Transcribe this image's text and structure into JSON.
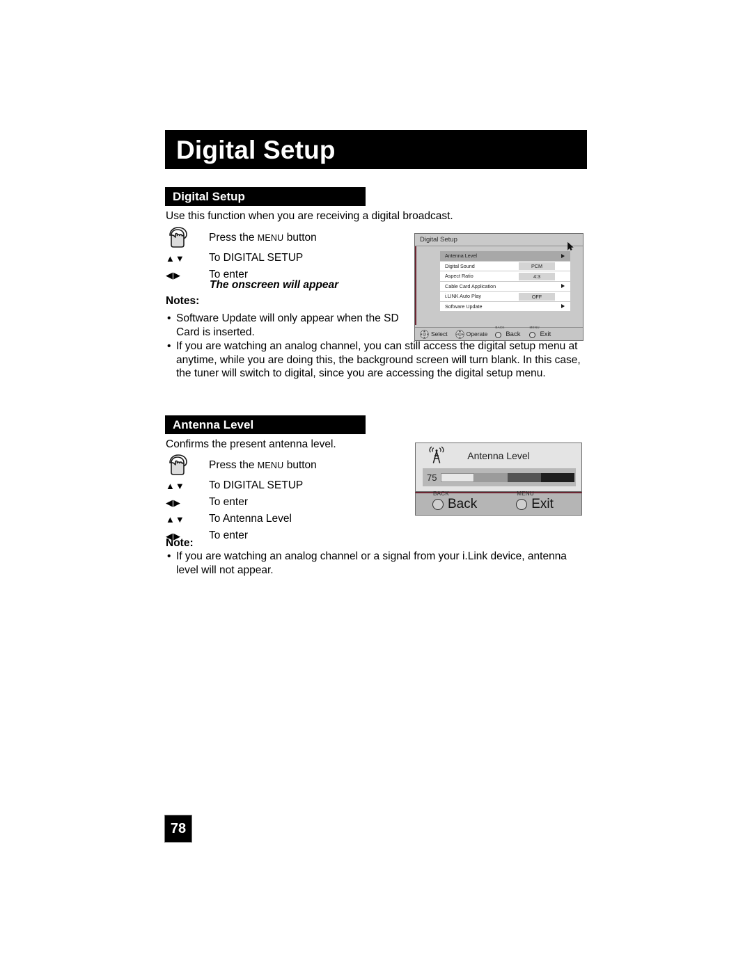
{
  "page": {
    "banner_title": "Digital Setup",
    "page_number": "78"
  },
  "sections": [
    {
      "heading": "Digital Setup",
      "intro": "Use this function when you are receiving a digital broadcast.",
      "steps": [
        {
          "icon": "hand-press-icon",
          "label_prefix": "Press the ",
          "label_smallcaps": "MENU",
          "label_suffix": " button"
        },
        {
          "icon": "up-down-arrows-icon",
          "arrows": "▲▼",
          "label": "To DIGITAL SETUP"
        },
        {
          "icon": "left-right-arrows-icon",
          "arrows": "◀▶",
          "label": "To enter"
        }
      ],
      "onscreen_note": "The onscreen will appear",
      "notes_heading": "Notes:",
      "notes": [
        "Software Update will only appear when the SD Card is inserted.",
        "If you are watching an analog channel, you can still access the digital setup menu at anytime, while you are doing this, the background screen will turn blank.  In this case, the tuner will switch to digital, since you are accessing the digital setup menu."
      ]
    },
    {
      "heading": "Antenna Level",
      "intro": "Confirms the present antenna level.",
      "steps": [
        {
          "icon": "hand-press-icon",
          "label_prefix": "Press the ",
          "label_smallcaps": "MENU",
          "label_suffix": " button"
        },
        {
          "icon": "up-down-arrows-icon",
          "arrows": "▲▼",
          "label": "To DIGITAL SETUP"
        },
        {
          "icon": "left-right-arrows-icon",
          "arrows": "◀▶",
          "label": "To enter"
        },
        {
          "icon": "up-down-arrows-icon",
          "arrows": "▲▼",
          "label": "To Antenna Level"
        },
        {
          "icon": "left-right-arrows-icon",
          "arrows": "◀▶",
          "label": "To enter"
        }
      ],
      "notes_heading": "Note:",
      "notes": [
        "If you are watching an analog channel or a signal from your i.Link device, antenna level will not appear."
      ]
    }
  ],
  "osd_menu": {
    "title": "Digital Setup",
    "rows": [
      {
        "label": "Antenna Level",
        "value": null,
        "arrow": true,
        "selected": true
      },
      {
        "label": "Digital Sound",
        "value": "PCM",
        "arrow": false,
        "selected": false
      },
      {
        "label": "Aspect Ratio",
        "value": "4:3",
        "arrow": false,
        "selected": false
      },
      {
        "label": "Cable Card Application",
        "value": null,
        "arrow": true,
        "selected": false
      },
      {
        "label": "i.LINK Auto Play",
        "value": "OFF",
        "arrow": false,
        "selected": false
      },
      {
        "label": "Software Update",
        "value": null,
        "arrow": true,
        "selected": false
      }
    ],
    "footer": [
      {
        "icon": "dpad-icon",
        "label": "Select",
        "tiny": null
      },
      {
        "icon": "dpad-icon",
        "label": "Operate",
        "tiny": null
      },
      {
        "icon": "circle-button-icon",
        "label": "Back",
        "tiny": "BACK"
      },
      {
        "icon": "circle-button-icon",
        "label": "Exit",
        "tiny": "MENU"
      }
    ]
  },
  "osd_antenna": {
    "icon": "antenna-tower-icon",
    "title": "Antenna Level",
    "level_value": "75",
    "level_segments": [
      "#e8e8e8",
      "#9b9b9b",
      "#545454",
      "#1e1e1e"
    ],
    "footer": [
      {
        "tiny": "BACK",
        "label": "Back"
      },
      {
        "tiny": "MENU",
        "label": "Exit"
      }
    ]
  },
  "colors": {
    "banner_bg": "#000000",
    "banner_text": "#ffffff",
    "osd_bg": "#c9c9c9",
    "osd_accent": "#6b2430"
  }
}
